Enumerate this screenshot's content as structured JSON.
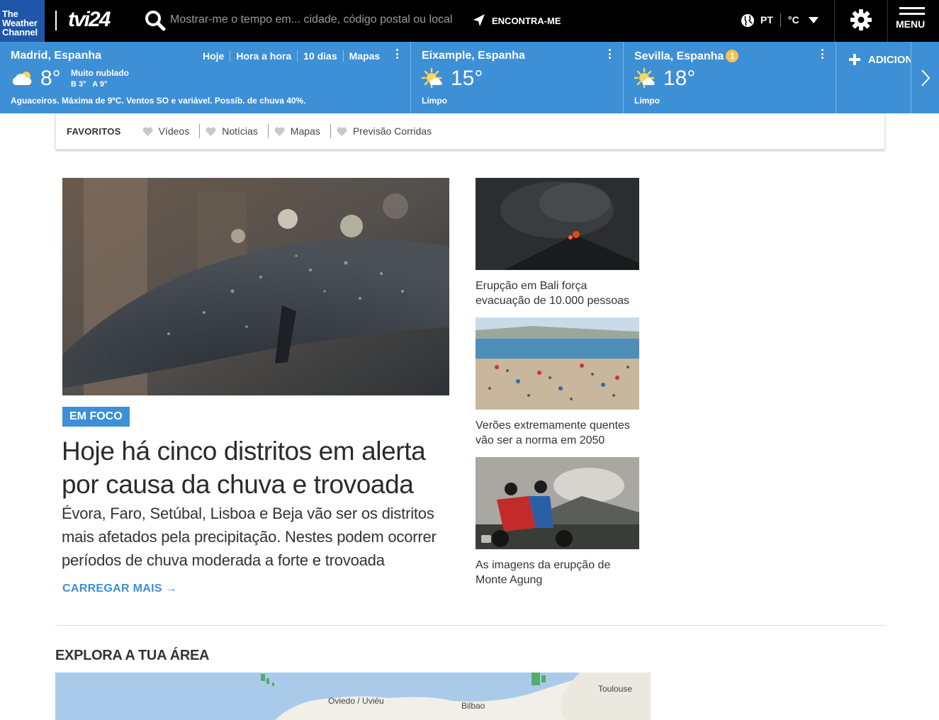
{
  "header": {
    "brand_logo_lines": [
      "The",
      "Weather",
      "Channel"
    ],
    "partner_logo": "tvi24",
    "search_placeholder": "Mostrar-me o tempo em... cidade, código postal ou local",
    "locate_label": "ENCONTRA-ME",
    "language": "PT",
    "unit": "°C",
    "menu_label": "MENU"
  },
  "locations": [
    {
      "name": "Madrid, Espanha",
      "temp": "8°",
      "condition": "Muito nublado",
      "low_high": "B 3°   A 9°",
      "summary": "Aguaceiros. Máxima de 9ºC. Ventos SO e variável. Possib. de chuva 40%.",
      "icon": "mostly-cloudy-icon",
      "tabs": [
        "Hoje",
        "Hora a hora",
        "10 dias",
        "Mapas"
      ]
    },
    {
      "name": "Eixample, Espanha",
      "temp": "15°",
      "condition": "Limpo",
      "icon": "sunny-icon"
    },
    {
      "name": "Sevilla, Espanha",
      "alert_count": "1",
      "temp": "18°",
      "condition": "Limpo",
      "icon": "sunny-icon"
    }
  ],
  "add_location_label": "ADICIONAR",
  "favorites": {
    "title": "FAVORITOS",
    "items": [
      "Vídeos",
      "Notícias",
      "Mapas",
      "Previsão Corridas"
    ]
  },
  "feature": {
    "badge": "EM FOCO",
    "headline": "Hoje há cinco distritos em alerta por causa da chuva e trovoada",
    "lede": "Évora, Faro, Setúbal, Lisboa e Beja vão ser os distritos mais afetados pela precipitação. Nestes podem ocorrer períodos de chuva moderada a forte e trovoada",
    "load_more": "CARREGAR MAIS →"
  },
  "side_stories": [
    {
      "caption": "Erupção em Bali força evacuação de 10.000 pessoas"
    },
    {
      "caption": "Verões extremamente quentes vão ser a norma em 2050"
    },
    {
      "caption": "As imagens da erupção de Monte Agung"
    }
  ],
  "explore": {
    "title": "EXPLORA A TUA ÁREA",
    "map_labels": [
      "Oviedo / Uviéu",
      "Bilbao",
      "Toulouse"
    ]
  },
  "colors": {
    "accent": "#3d8fd6",
    "header_bg": "#000000",
    "brand_blue": "#1f56a8",
    "alert": "#f5c44b"
  }
}
